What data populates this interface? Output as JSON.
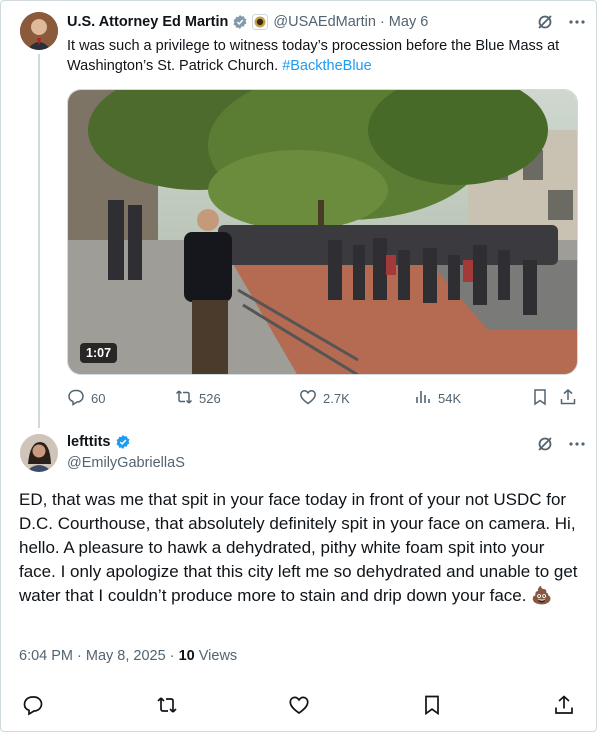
{
  "parent_tweet": {
    "display_name": "U.S. Attorney Ed Martin",
    "handle": "@USAEdMartin",
    "separator": "·",
    "date": "May 6",
    "text_plain": "It was such a privilege to witness today’s procession before the Blue Mass at Washington’s St. Patrick Church.",
    "hashtag": "#BacktheBlue",
    "video_duration": "1:07",
    "replies": "60",
    "retweets": "526",
    "likes": "2.7K",
    "views": "54K"
  },
  "reply_tweet": {
    "display_name": "lefttits",
    "handle": "@EmilyGabriellaS",
    "text": "ED, that was me that spit in your face today in front of your not USDC for D.C. Courthouse, that absolutely definitely spit in your face on camera. Hi, hello. A pleasure to hawk a dehydrated, pithy white foam spit into your face. I only apologize that this city left me so dehydrated and unable to get water that I couldn’t produce more to stain and drip down your face.",
    "emoji": "💩",
    "time_date": "6:04 PM · May 8, 2025 ·",
    "views_count": "10",
    "views_label": "Views"
  },
  "colors": {
    "accent": "#1d9bf0",
    "text": "#0f1419",
    "secondary": "#536471",
    "border": "#cfd9de"
  },
  "icons": [
    "verified-icon",
    "affiliate-badge-icon",
    "grok-icon",
    "more-icon",
    "reply-icon",
    "retweet-icon",
    "like-icon",
    "views-icon",
    "bookmark-icon",
    "share-icon"
  ]
}
